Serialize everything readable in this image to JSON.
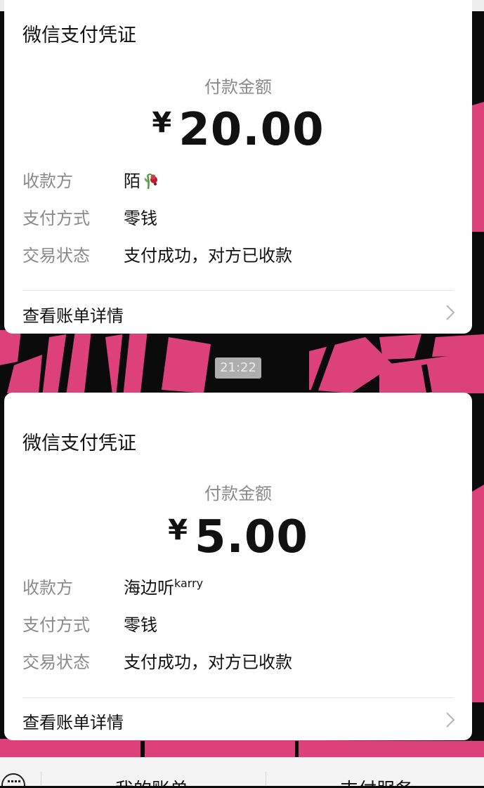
{
  "receipts": [
    {
      "title": "微信支付凭证",
      "amount_label": "付款金额",
      "currency": "¥",
      "amount": "20.00",
      "payee_label": "收款方",
      "payee": "陌",
      "payee_suffix": "",
      "method_label": "支付方式",
      "method": "零钱",
      "status_label": "交易状态",
      "status": "支付成功，对方已收款",
      "detail_link": "查看账单详情"
    },
    {
      "title": "微信支付凭证",
      "amount_label": "付款金额",
      "currency": "¥",
      "amount": "5.00",
      "payee_label": "收款方",
      "payee": "海边听",
      "payee_suffix": "karry",
      "method_label": "支付方式",
      "method": "零钱",
      "status_label": "交易状态",
      "status": "支付成功，对方已收款",
      "detail_link": "查看账单详情"
    }
  ],
  "timestamp": "21:22",
  "bottom_menu": {
    "items": [
      "我的账单",
      "支付服务"
    ],
    "keyboard_icon": "keyboard-icon"
  },
  "colors": {
    "background": "#0b0b0b",
    "accent_pink": "#e8457f",
    "card": "#ffffff",
    "label_gray": "#8a8a8a"
  },
  "icons": {
    "payee_emoji_1": "wilted-rose-icon",
    "detail_chevron": "chevron-right-icon"
  }
}
